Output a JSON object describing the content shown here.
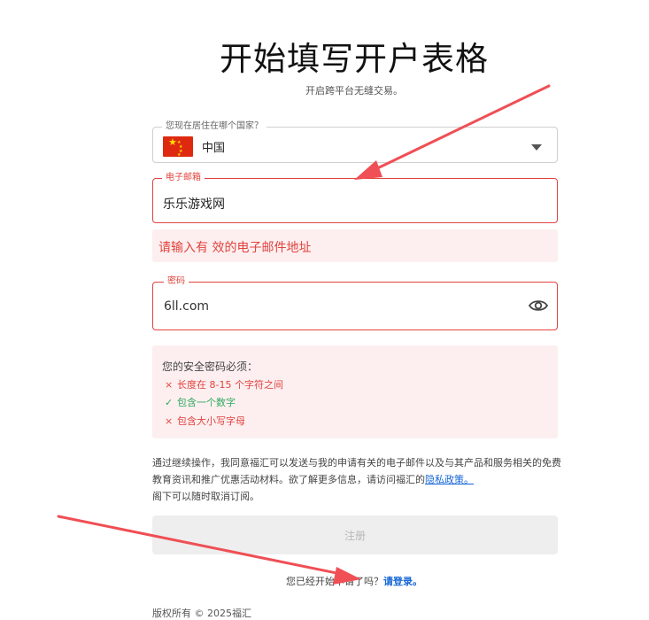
{
  "header": {
    "title": "开始填写开户表格",
    "subtitle": "开启跨平台无缝交易。"
  },
  "country_field": {
    "label": "您现在居住在哪个国家？",
    "value": "中国",
    "flag_icon": "china-flag-icon"
  },
  "email_field": {
    "label": "电子邮箱",
    "value": "乐乐游戏网",
    "error": "请输入有 效的电子邮件地址"
  },
  "password_field": {
    "label": "密码",
    "value": "6ll.com",
    "toggle_icon": "eye-icon"
  },
  "password_rules": {
    "heading": "您的安全密码必须：",
    "items": [
      {
        "mark": "×",
        "text": "长度在 8-15 个字符之间",
        "status": "fail"
      },
      {
        "mark": "✓",
        "text": "包含一个数字",
        "status": "pass"
      },
      {
        "mark": "×",
        "text": "包含大小写字母",
        "status": "fail"
      }
    ]
  },
  "consent": {
    "text": "通过继续操作，我同意福汇可以发送与我的申请有关的电子邮件以及与其产品和服务相关的免费教育资讯和推广优惠活动材料。欲了解更多信息，请访问福汇的",
    "link": "隐私政策。",
    "tail": "阁下可以随时取消订阅。"
  },
  "register_button": {
    "label": "注册"
  },
  "login_prompt": {
    "text": "您已经开始申请了吗？",
    "link": "请登录。"
  },
  "footer": {
    "text": "版权所有 © 2025福汇"
  },
  "colors": {
    "error": "#e0443e",
    "error_bg": "#fdeff0",
    "success": "#2faa5e",
    "link": "#1566d6",
    "annotation_arrow": "#ef4f55"
  }
}
